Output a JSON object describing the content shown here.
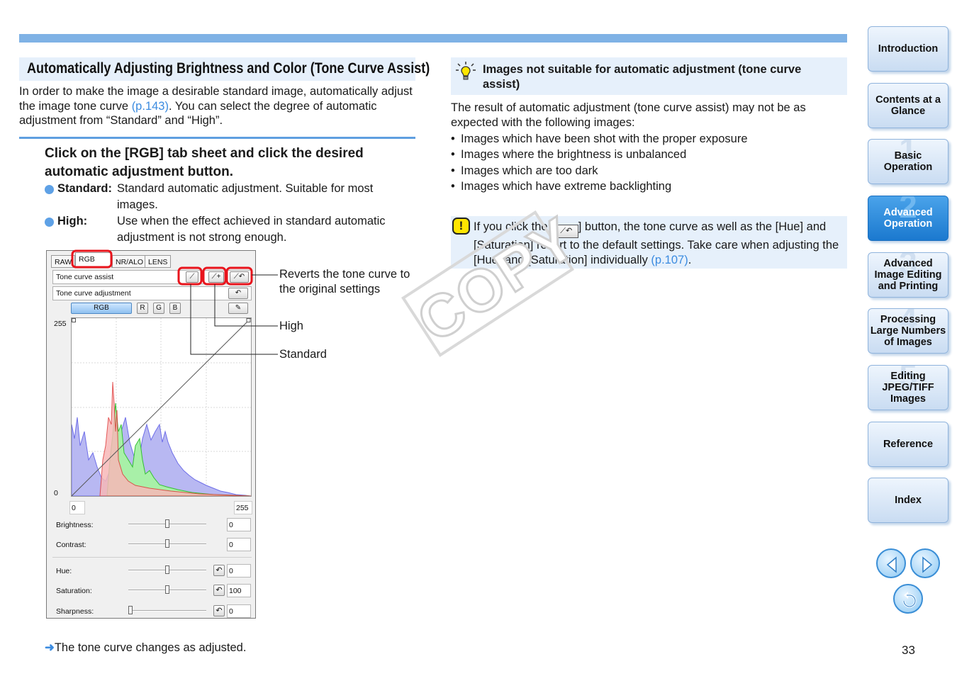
{
  "section": {
    "title": "Automatically Adjusting Brightness and Color (Tone Curve Assist)",
    "intro_before": "In order to make the image a desirable standard image, automatically adjust the image tone curve ",
    "intro_link": "(p.143)",
    "intro_after": ". You can select the degree of automatic adjustment from “Standard” and “High”."
  },
  "step": {
    "heading": "Click on the [RGB] tab sheet and click the desired automatic adjustment button.",
    "options": [
      {
        "name": "Standard:",
        "desc": "Standard automatic adjustment. Suitable for most images."
      },
      {
        "name": "High:",
        "desc": "Use when the effect achieved in standard automatic adjustment is not strong enough."
      }
    ],
    "result_note": "The tone curve changes as adjusted.",
    "result_arrow": "➜"
  },
  "panel": {
    "tabs": [
      "RAW",
      "RGB",
      "NR/ALO",
      "LENS"
    ],
    "tone_curve_assist": "Tone curve assist",
    "tone_curve_adjustment": "Tone curve adjustment",
    "channels": [
      "RGB",
      "R",
      "G",
      "B"
    ],
    "graph_y_max": "255",
    "graph_y_min": "0",
    "input_min": "0",
    "input_max": "255",
    "sliders": [
      {
        "label": "Brightness:",
        "value": "0",
        "level": 0.5
      },
      {
        "label": "Contrast:",
        "value": "0",
        "level": 0.5
      },
      {
        "label": "Hue:",
        "value": "0",
        "level": 0.5
      },
      {
        "label": "Saturation:",
        "value": "100",
        "level": 0.5
      },
      {
        "label": "Sharpness:",
        "value": "0",
        "level": 0.0
      }
    ]
  },
  "callouts": {
    "revert": "Reverts the tone curve to the original settings",
    "high": "High",
    "standard": "Standard"
  },
  "tip": {
    "title": "Images not suitable for automatic adjustment (tone curve assist)",
    "body": "The result of automatic adjustment (tone curve assist) may not be as expected with the following images:",
    "items": [
      "Images which have been shot with the proper exposure",
      "Images where the brightness is unbalanced",
      "Images which are too dark",
      "Images which have extreme backlighting"
    ]
  },
  "caution": {
    "icon": "!",
    "before": "If you click the [",
    "after": "] button, the tone curve as well as the [Hue] and [Saturation] revert to the default settings. Take care when adjusting the [Hue] and [Saturation] individually ",
    "link": "(p.107)",
    "end": "."
  },
  "watermark": "COPY",
  "nav": {
    "items": [
      {
        "label": "Introduction",
        "num": ""
      },
      {
        "label": "Contents at a Glance",
        "num": ""
      },
      {
        "label": "Basic Operation",
        "num": "1"
      },
      {
        "label": "Advanced Operation",
        "num": "2"
      },
      {
        "label": "Advanced Image Editing and Printing",
        "num": "3"
      },
      {
        "label": "Processing Large Numbers of Images",
        "num": "4"
      },
      {
        "label": "Editing JPEG/TIFF Images",
        "num": "5"
      },
      {
        "label": "Reference",
        "num": ""
      },
      {
        "label": "Index",
        "num": ""
      }
    ],
    "active_index": 3
  },
  "page_number": "33",
  "colors": {
    "accent": "#3b8be0",
    "highlight_box": "#e6f0fb",
    "callout_red": "#e8141c",
    "nav_active": "#1b79cf"
  }
}
